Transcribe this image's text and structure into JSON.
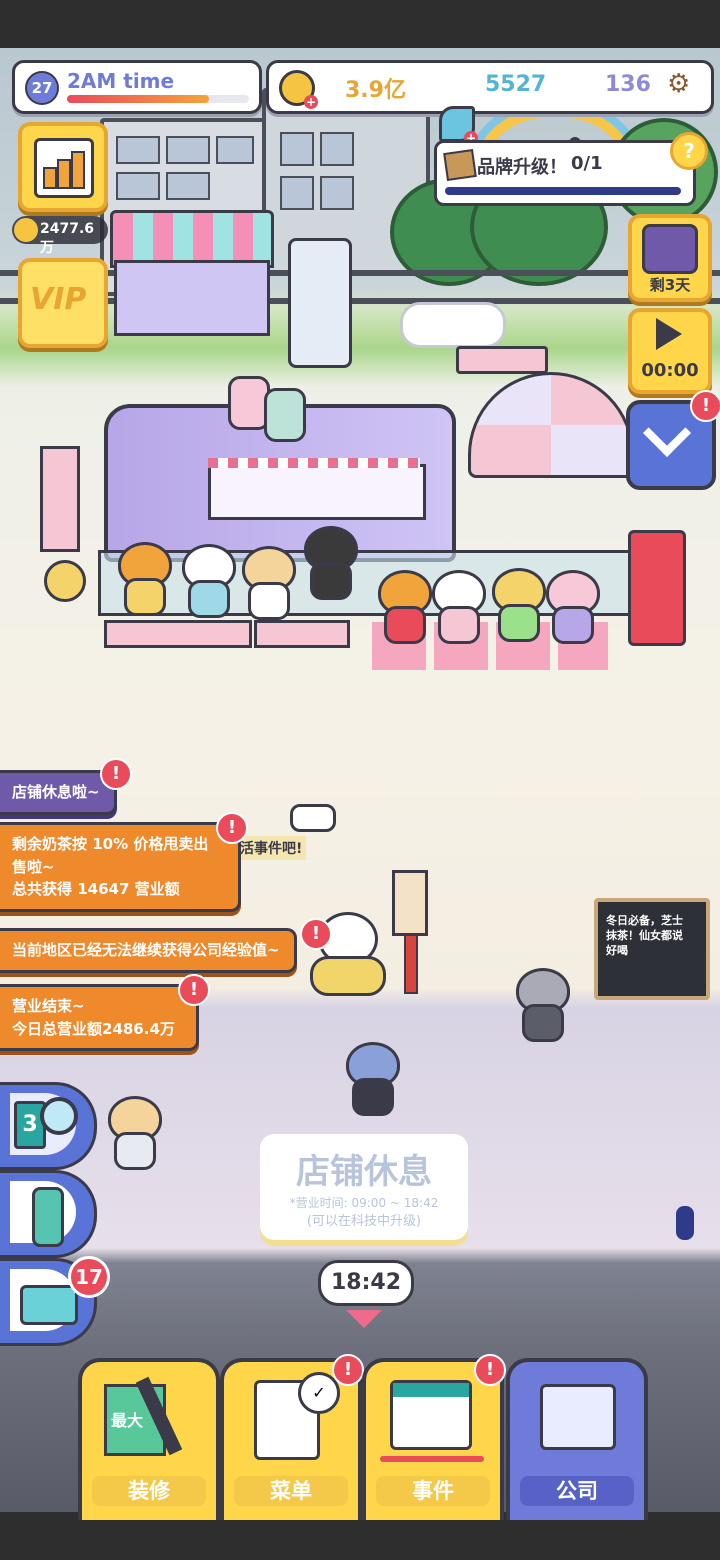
{
  "top_bar": {
    "level": "27",
    "player_name": "2AM time",
    "gold": "3.9亿",
    "gems": "5527",
    "crystals": "136"
  },
  "brand_upgrade": {
    "label": "品牌升级！",
    "progress": "0/1"
  },
  "left_stats": {
    "income_rate": "2477.6万",
    "vip_label": "VIP"
  },
  "right_panel": {
    "event_days": "剩3天",
    "ad_timer": "00:00"
  },
  "notifications": [
    {
      "text": "店铺休息啦~"
    },
    {
      "line1": "剩余奶茶按 10% 价格甩卖出",
      "line2": "售啦~",
      "line3": "总共获得 14647 营业额"
    },
    {
      "text": "当前地区已经无法继续获得公司经验值~"
    },
    {
      "line1": "营业结束~",
      "line2": "今日总营业额2486.4万"
    }
  ],
  "hidden_fragment": "活事件吧!",
  "chalkboard": {
    "line1": "冬日必备，芝士",
    "line2": "抹茶！仙女都说",
    "line3": "好喝"
  },
  "shop_status": {
    "title": "店铺休息",
    "hours": "*营业时间: 09:00 ~ 18:42",
    "hint": "(可以在科技中升级)"
  },
  "clock": "18:42",
  "side_tools": {
    "search_count": "3",
    "item_badge": "17"
  },
  "tabs": [
    {
      "label": "装修",
      "badge_text": "最大"
    },
    {
      "label": "菜单"
    },
    {
      "label": "事件"
    },
    {
      "label": "公司"
    }
  ],
  "colors": {
    "accent_blue": "#6f7bd9",
    "accent_yellow": "#ffd54a",
    "alert_red": "#e94b5a",
    "notif_orange": "#ee8a2c"
  }
}
